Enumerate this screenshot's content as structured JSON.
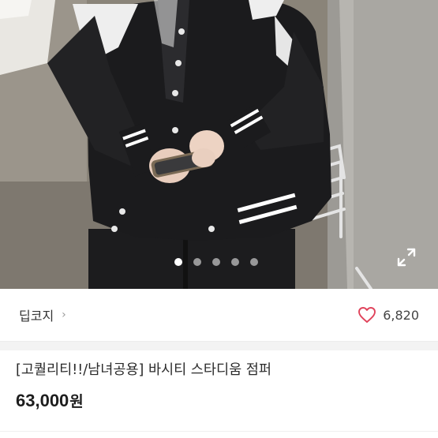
{
  "product": {
    "image_alt": "varsity stadium jumper photo",
    "carousel": {
      "count": 5,
      "active_index": 0
    }
  },
  "seller": {
    "name": "딥코지",
    "chevron": "›"
  },
  "likes": {
    "icon": "heart-outline-icon",
    "count": "6,820",
    "color": "#e0435b"
  },
  "listing": {
    "title": "[고퀄리티!!/남녀공용] 바시티 스타디움 점퍼",
    "price": "63,000",
    "currency": "원"
  }
}
